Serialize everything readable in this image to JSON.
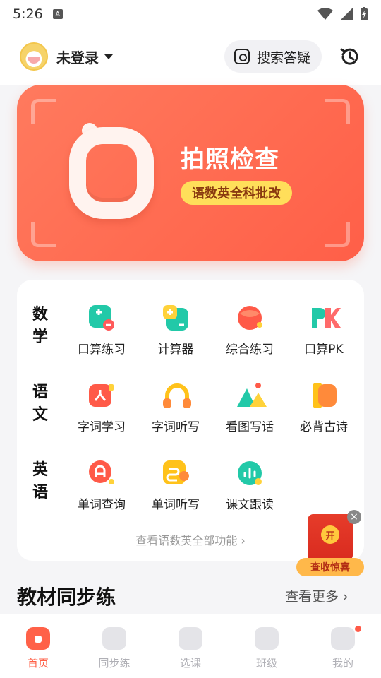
{
  "status": {
    "time": "5:26",
    "badge": "A"
  },
  "header": {
    "login_label": "未登录",
    "search_label": "搜索答疑"
  },
  "hero": {
    "title": "拍照检查",
    "tag": "语数英全科批改"
  },
  "subjects": [
    {
      "label": "数学",
      "items": [
        {
          "label": "口算练习",
          "icon": "math-oral-icon"
        },
        {
          "label": "计算器",
          "icon": "calculator-icon"
        },
        {
          "label": "综合练习",
          "icon": "comprehensive-icon"
        },
        {
          "label": "口算PK",
          "icon": "pk-icon"
        }
      ]
    },
    {
      "label": "语文",
      "items": [
        {
          "label": "字词学习",
          "icon": "word-study-icon"
        },
        {
          "label": "字词听写",
          "icon": "headphones-icon"
        },
        {
          "label": "看图写话",
          "icon": "picture-writing-icon"
        },
        {
          "label": "必背古诗",
          "icon": "poem-book-icon"
        }
      ]
    },
    {
      "label": "英语",
      "items": [
        {
          "label": "单词查询",
          "icon": "word-lookup-icon"
        },
        {
          "label": "单词听写",
          "icon": "word-dictation-icon"
        },
        {
          "label": "课文跟读",
          "icon": "read-along-icon"
        }
      ]
    }
  ],
  "features_footer": {
    "see_all": "查看语数英全部功能 ›"
  },
  "section": {
    "title": "教材同步练",
    "see_more": "查看更多 ›"
  },
  "promo": {
    "coin": "开",
    "label": "查收惊喜"
  },
  "tabs": [
    {
      "label": "首页",
      "active": true
    },
    {
      "label": "同步练",
      "active": false
    },
    {
      "label": "选课",
      "active": false
    },
    {
      "label": "班级",
      "active": false
    },
    {
      "label": "我的",
      "active": false
    }
  ],
  "colors": {
    "accent": "#ff6148",
    "hero": "#ff6a50",
    "tag": "#ffde5a"
  }
}
